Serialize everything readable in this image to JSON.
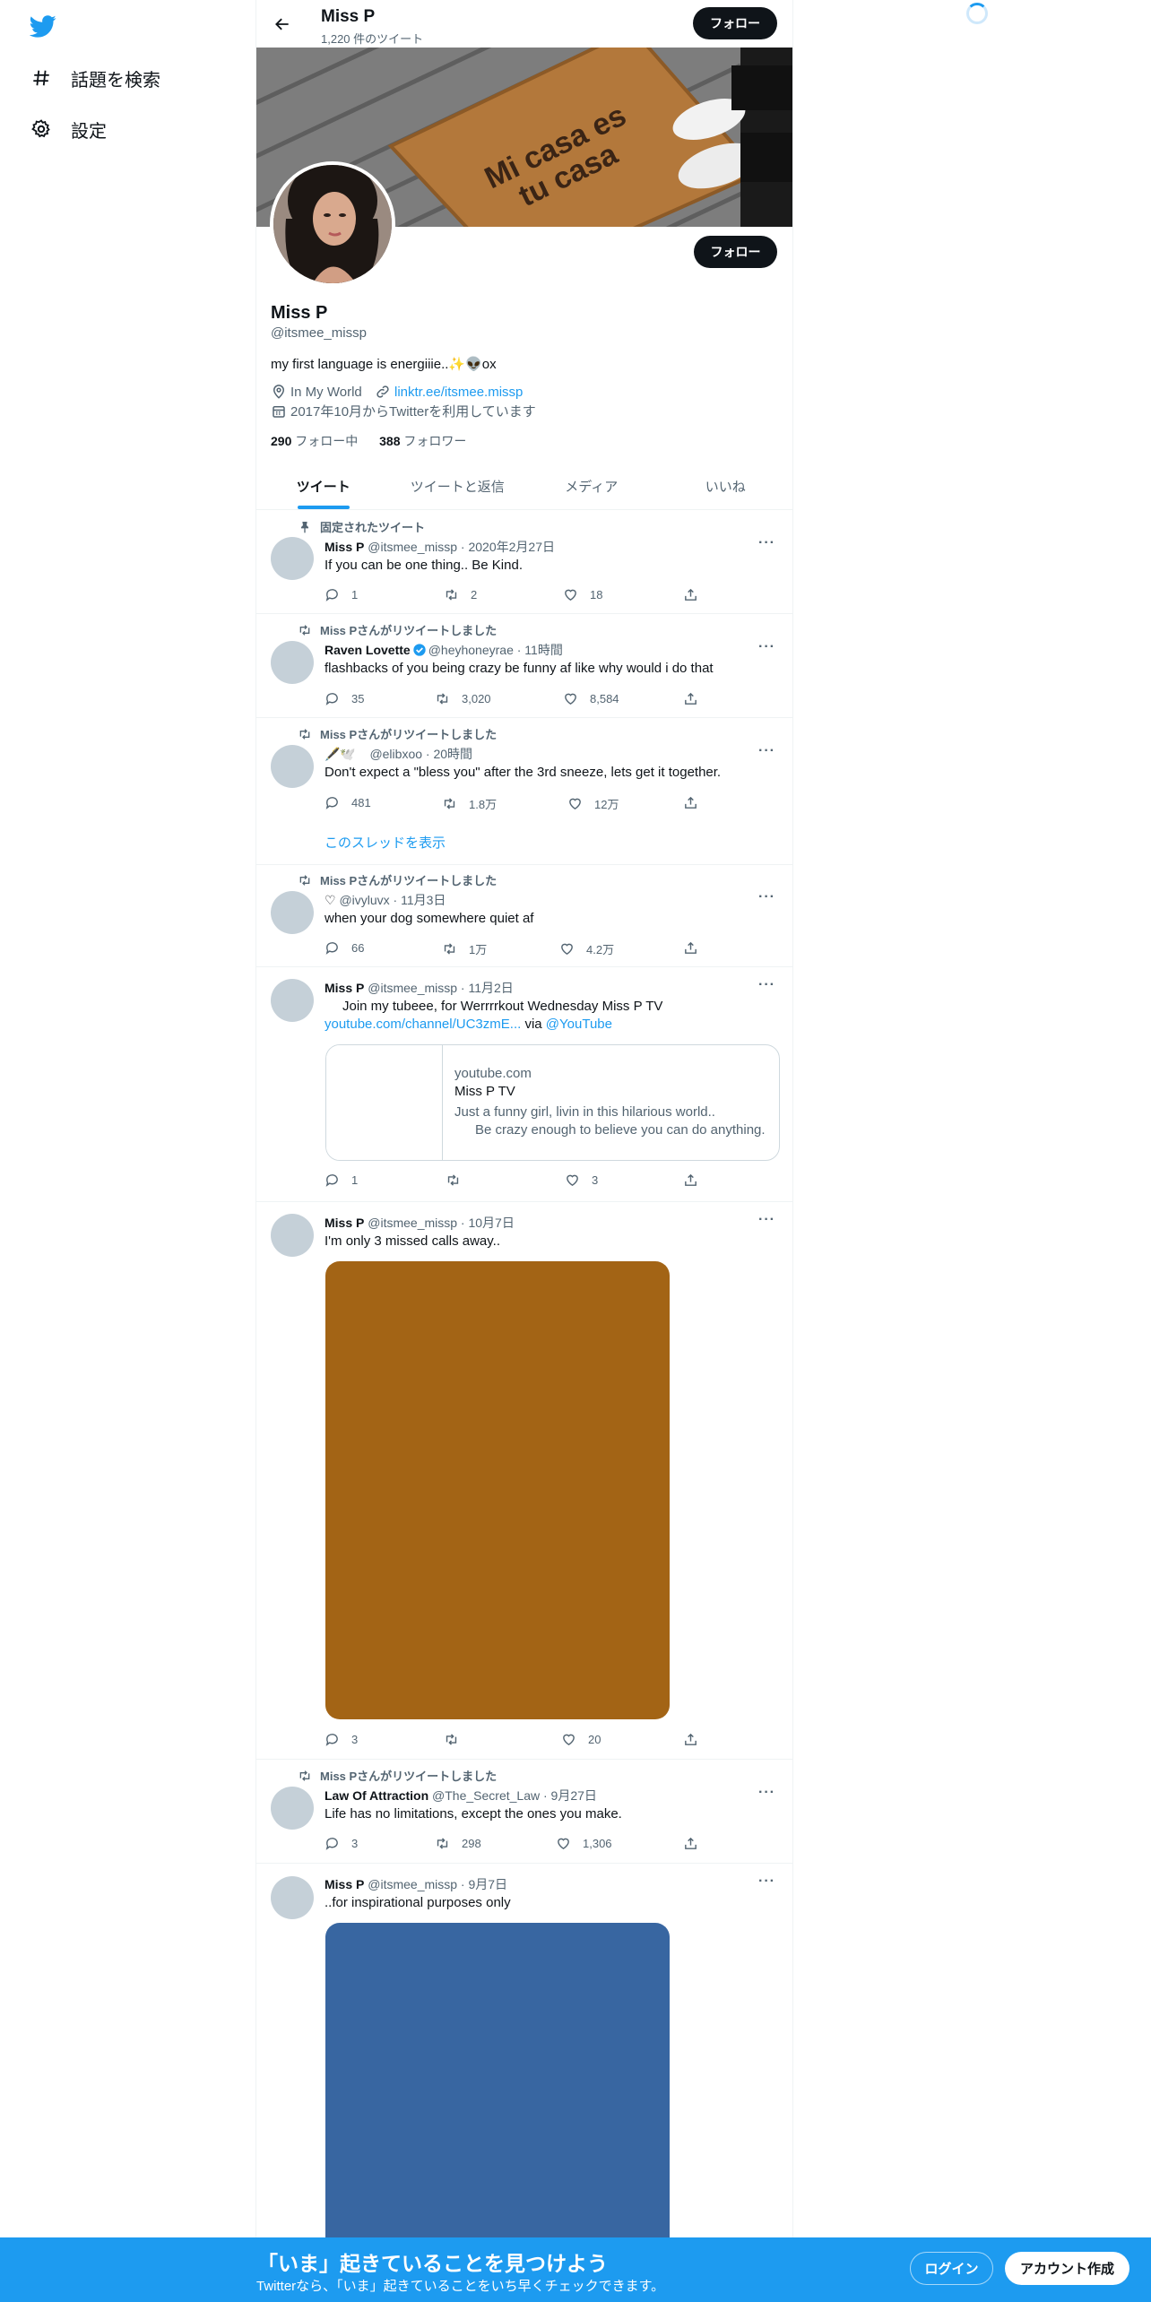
{
  "nav": {
    "explore_label": "話題を検索",
    "settings_label": "設定"
  },
  "header": {
    "name": "Miss P",
    "tweet_count": "1,220 件のツイート",
    "follow_label": "フォロー"
  },
  "profile": {
    "name": "Miss P",
    "handle": "@itsmee_missp",
    "bio": "my first language is energiiie..✨👽ox",
    "location": "In My World",
    "url": "linktr.ee/itsmee.missp",
    "joined": "2017年10月からTwitterを利用しています",
    "following_count": "290",
    "following_label": "フォロー中",
    "followers_count": "388",
    "followers_label": "フォロワー",
    "follow_label": "フォロー",
    "banner_mat_text_1": "Mi casa es",
    "banner_mat_text_2": "tu casa"
  },
  "tabs": [
    {
      "label": "ツイート",
      "active": true
    },
    {
      "label": "ツイートと返信",
      "active": false
    },
    {
      "label": "メディア",
      "active": false
    },
    {
      "label": "いいね",
      "active": false
    }
  ],
  "tweets": [
    {
      "social": "固定されたツイート",
      "name": "Miss P",
      "meta": "@itsmee_missp · 2020年2月27日",
      "text": "If you can be one thing.. Be Kind.",
      "replies": "1",
      "retweets": "2",
      "likes": "18"
    },
    {
      "social": "Miss Pさんがリツイートしました",
      "name": "Raven Lovette",
      "meta": "@heyhoneyrae · 11時間",
      "text": "flashbacks of you being crazy be funny af like why would i do that",
      "replies": "35",
      "retweets": "3,020",
      "likes": "8,584"
    },
    {
      "social": "Miss Pさんがリツイートしました",
      "name": "🖋️🕊️",
      "meta": "@elibxoo · 20時間",
      "text": "Don't expect a \"bless you\" after the 3rd sneeze, lets get it together.",
      "replies": "481",
      "retweets": "1.8万",
      "likes": "12万",
      "thread_label": "このスレッドを表示"
    },
    {
      "social": "Miss Pさんがリツイートしました",
      "name": "♡",
      "meta": "@ivyluvx · 11月3日",
      "text": "when your dog somewhere quiet af",
      "replies": "66",
      "retweets": "1万",
      "likes": "4.2万"
    },
    {
      "name": "Miss P",
      "meta": "@itsmee_missp · 11月2日",
      "text": "Join my tubeee, for Werrrrkout Wednesday    Miss P TV",
      "link": "youtube.com/channel/UC3zmE...",
      "via": " via ",
      "via_handle": "@YouTube",
      "card": {
        "domain": "youtube.com",
        "title": "Miss P TV",
        "desc_1": "Just a funny girl, livin in this hilarious world..",
        "desc_2": "Be crazy enough to believe you can do anything."
      },
      "replies": "1",
      "retweets": "",
      "likes": "3"
    },
    {
      "name": "Miss P",
      "meta": "@itsmee_missp · 10月7日",
      "text": "I'm only 3 missed calls away..",
      "media_color": "#a36415",
      "replies": "3",
      "retweets": "",
      "likes": "20"
    },
    {
      "social": "Miss Pさんがリツイートしました",
      "name": "Law Of Attraction",
      "meta": "@The_Secret_Law · 9月27日",
      "text": "Life has no limitations, except the ones you make.",
      "replies": "3",
      "retweets": "298",
      "likes": "1,306"
    },
    {
      "name": "Miss P",
      "meta": "@itsmee_missp · 9月7日",
      "text": "..for inspirational purposes only",
      "media_color": "#3866a1"
    }
  ],
  "bottom_bar": {
    "title": "「いま」起きていることを見つけよう",
    "subtitle": "Twitterなら、「いま」起きていることをいち早くチェックできます。",
    "login_label": "ログイン",
    "signup_label": "アカウント作成"
  }
}
